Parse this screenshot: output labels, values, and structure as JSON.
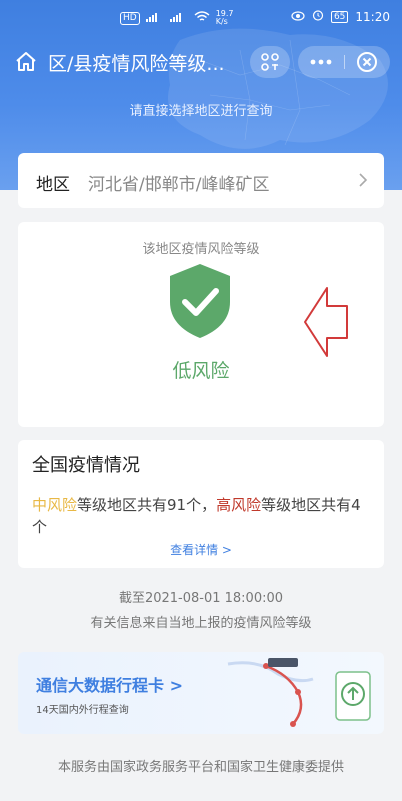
{
  "status_bar": {
    "hd_label": "HD",
    "signal1": "4G",
    "signal2": "4G",
    "speed_value": "19.7",
    "speed_unit": "K/s",
    "battery": "65",
    "time": "11:20"
  },
  "header": {
    "title": "区/县疫情风险等级...",
    "subtitle": "请直接选择地区进行查询"
  },
  "region": {
    "label": "地区",
    "value": "河北省/邯郸市/峰峰矿区"
  },
  "risk": {
    "caption": "该地区疫情风险等级",
    "level": "低风险"
  },
  "national": {
    "title": "全国疫情情况",
    "mid_label": "中风险",
    "text_part1": "等级地区共有91个，",
    "high_label": "高风险",
    "text_part2": "等级地区共有4个",
    "detail_link": "查看详情 >"
  },
  "info": {
    "as_of": "截至2021-08-01 18:00:00",
    "source": "有关信息来自当地上报的疫情风险等级"
  },
  "travel_card": {
    "title": "通信大数据行程卡 >",
    "subtitle": "14天国内外行程查询"
  },
  "footer": "本服务由国家政务服务平台和国家卫生健康委提供",
  "colors": {
    "header_blue": "#3f7fe0",
    "low_risk_green": "#5ca86a",
    "mid_risk_yellow": "#e8b845",
    "high_risk_red": "#c0392b"
  }
}
